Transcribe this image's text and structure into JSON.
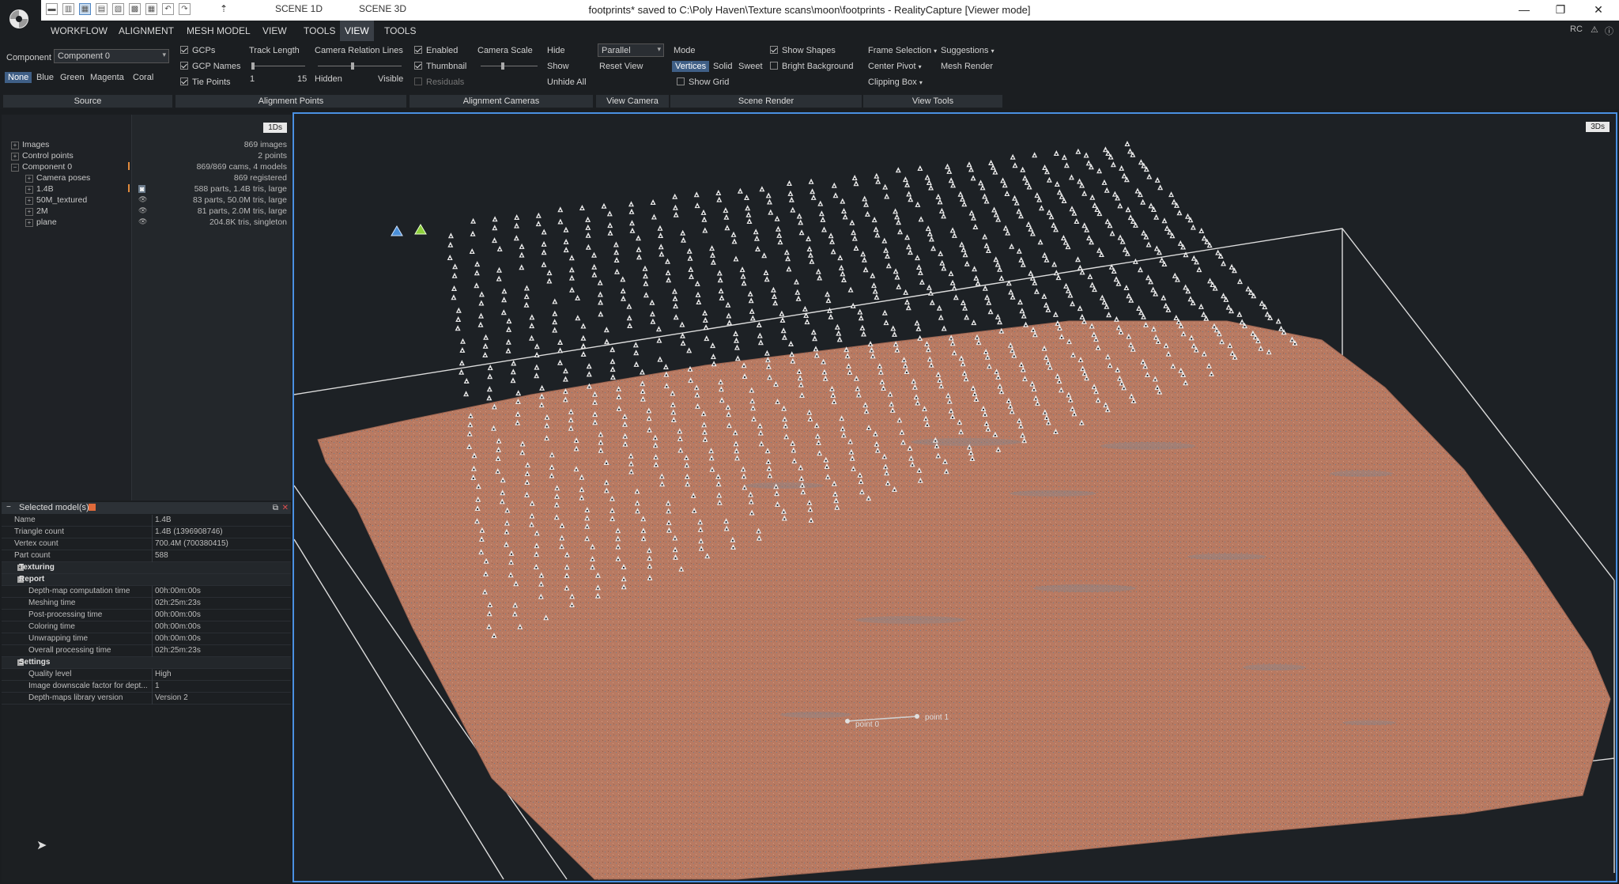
{
  "titlebar": {
    "title": "footprints* saved to C:\\Poly Haven\\Texture scans\\moon\\footprints - RealityCapture [Viewer mode]",
    "scene_tabs": [
      "SCENE 1D",
      "SCENE 3D"
    ],
    "quick_access_menu_glyph": "⇡",
    "window_controls": {
      "minimize": "—",
      "restore": "❐",
      "close": "✕"
    }
  },
  "menubar": {
    "items": [
      "WORKFLOW",
      "ALIGNMENT",
      "MESH MODEL",
      "VIEW",
      "TOOLS",
      "VIEW",
      "TOOLS"
    ],
    "active_index": 5,
    "right": {
      "rc": "RC"
    }
  },
  "ribbon": {
    "source": {
      "component_label": "Component",
      "component_value": "Component 0",
      "colors": [
        "None",
        "Blue",
        "Green",
        "Magenta",
        "Coral"
      ],
      "selected_color": "None",
      "group_label": "Source"
    },
    "alignment_points": {
      "gcps": "GCPs",
      "gcp_names": "GCP Names",
      "tie_points": "Tie Points",
      "track_length_label": "Track Length",
      "track_min": "1",
      "track_max": "15",
      "camera_relation_label": "Camera Relation Lines",
      "hidden_label": "Hidden",
      "visible_label": "Visible",
      "group_label": "Alignment Points"
    },
    "alignment_cameras": {
      "enabled": "Enabled",
      "thumbnail": "Thumbnail",
      "residuals": "Residuals",
      "camera_scale_label": "Camera Scale",
      "hide": "Hide",
      "show": "Show",
      "unhide_all": "Unhide All",
      "group_label": "Alignment Cameras"
    },
    "view_camera": {
      "projection_value": "Parallel",
      "reset_view": "Reset View",
      "group_label": "View Camera"
    },
    "scene_render": {
      "mode_label": "Mode",
      "modes": [
        "Vertices",
        "Solid",
        "Sweet"
      ],
      "selected_mode": "Vertices",
      "show_grid": "Show Grid",
      "show_shapes": "Show Shapes",
      "bright_background": "Bright Background",
      "group_label": "Scene Render"
    },
    "view_tools": {
      "frame_selection": "Frame Selection",
      "suggestions": "Suggestions",
      "center_pivot": "Center Pivot",
      "mesh_render": "Mesh Render",
      "clipping_box": "Clipping Box",
      "group_label": "View Tools"
    }
  },
  "tree": {
    "tag": "1Ds",
    "rows": [
      {
        "label": "Images",
        "info": "869 images"
      },
      {
        "label": "Control points",
        "info": "2 points"
      },
      {
        "label": "Component 0",
        "info": "869/869 cams, 4 models"
      },
      {
        "label": "Camera poses",
        "info": "869 registered"
      },
      {
        "label": "1.4B",
        "info": "588 parts, 1.4B tris, large"
      },
      {
        "label": "50M_textured",
        "info": "83 parts, 50.0M tris, large"
      },
      {
        "label": "2M",
        "info": "81 parts, 2.0M tris, large"
      },
      {
        "label": "plane",
        "info": "204.8K tris, singleton"
      }
    ]
  },
  "properties": {
    "title": "Selected model(s)",
    "rows": [
      {
        "type": "row",
        "key": "Name",
        "value": "1.4B"
      },
      {
        "type": "row",
        "key": "Triangle count",
        "value": "1.4B (1396908746)"
      },
      {
        "type": "row",
        "key": "Vertex count",
        "value": "700.4M (700380415)"
      },
      {
        "type": "row",
        "key": "Part count",
        "value": "588"
      },
      {
        "type": "section",
        "key": "Texturing",
        "sign": "+"
      },
      {
        "type": "section",
        "key": "Report",
        "sign": "−"
      },
      {
        "type": "sub",
        "key": "Depth-map computation time",
        "value": "00h:00m:00s"
      },
      {
        "type": "sub",
        "key": "Meshing time",
        "value": "02h:25m:23s"
      },
      {
        "type": "sub",
        "key": "Post-processing time",
        "value": "00h:00m:00s"
      },
      {
        "type": "sub",
        "key": "Coloring time",
        "value": "00h:00m:00s"
      },
      {
        "type": "sub",
        "key": "Unwrapping time",
        "value": "00h:00m:00s"
      },
      {
        "type": "sub",
        "key": "Overall processing time",
        "value": "02h:25m:23s"
      },
      {
        "type": "section",
        "key": "Settings",
        "sign": "−"
      },
      {
        "type": "sub",
        "key": "Quality level",
        "value": "High"
      },
      {
        "type": "sub",
        "key": "Image downscale factor for dept...",
        "value": "1"
      },
      {
        "type": "sub",
        "key": "Depth-maps library version",
        "value": "Version 2"
      }
    ]
  },
  "viewport": {
    "tag": "3Ds",
    "point0": "point 0",
    "point1": "point 1"
  },
  "colors": {
    "terrain": "#b87a62",
    "accent": "#4a90e2",
    "camera_icon": "#e8e8e8",
    "gcp_blue": "#4a8fd8",
    "gcp_green": "#8ccf3a"
  }
}
